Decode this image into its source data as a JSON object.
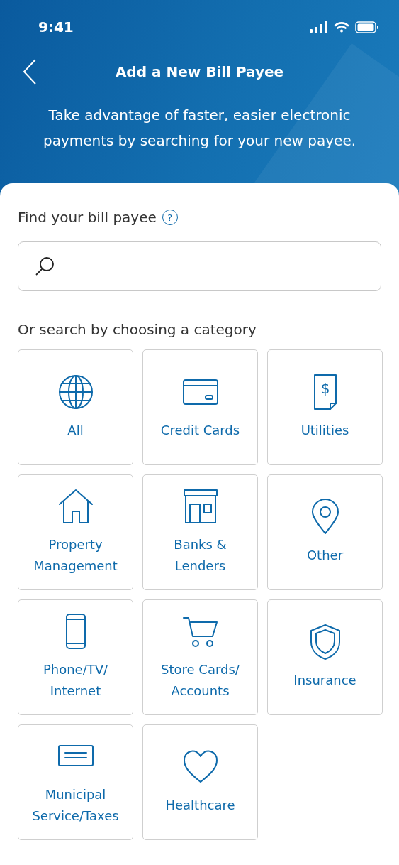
{
  "status_bar": {
    "time": "9:41"
  },
  "header": {
    "title": "Add a New Bill Payee",
    "subtitle": "Take advantage of faster, easier electronic payments by searching for your new payee."
  },
  "search": {
    "label": "Find your bill payee",
    "help": "?"
  },
  "categories": {
    "heading": "Or search by choosing a category",
    "items": [
      {
        "kind": "globe",
        "label": "All"
      },
      {
        "kind": "card",
        "label": "Credit Cards"
      },
      {
        "kind": "bill",
        "symbol": "$",
        "label": "Utilities"
      },
      {
        "kind": "house",
        "label": "Property\nManagement"
      },
      {
        "kind": "bank",
        "label": "Banks &\nLenders"
      },
      {
        "kind": "pin",
        "label": "Other"
      },
      {
        "kind": "phone",
        "label": "Phone/TV/\nInternet"
      },
      {
        "kind": "cart",
        "label": "Store Cards/\nAccounts"
      },
      {
        "kind": "shield",
        "label": "Insurance"
      },
      {
        "kind": "cheque",
        "label": "Municipal\nService/Taxes"
      },
      {
        "kind": "heart",
        "label": "Healthcare"
      }
    ]
  }
}
